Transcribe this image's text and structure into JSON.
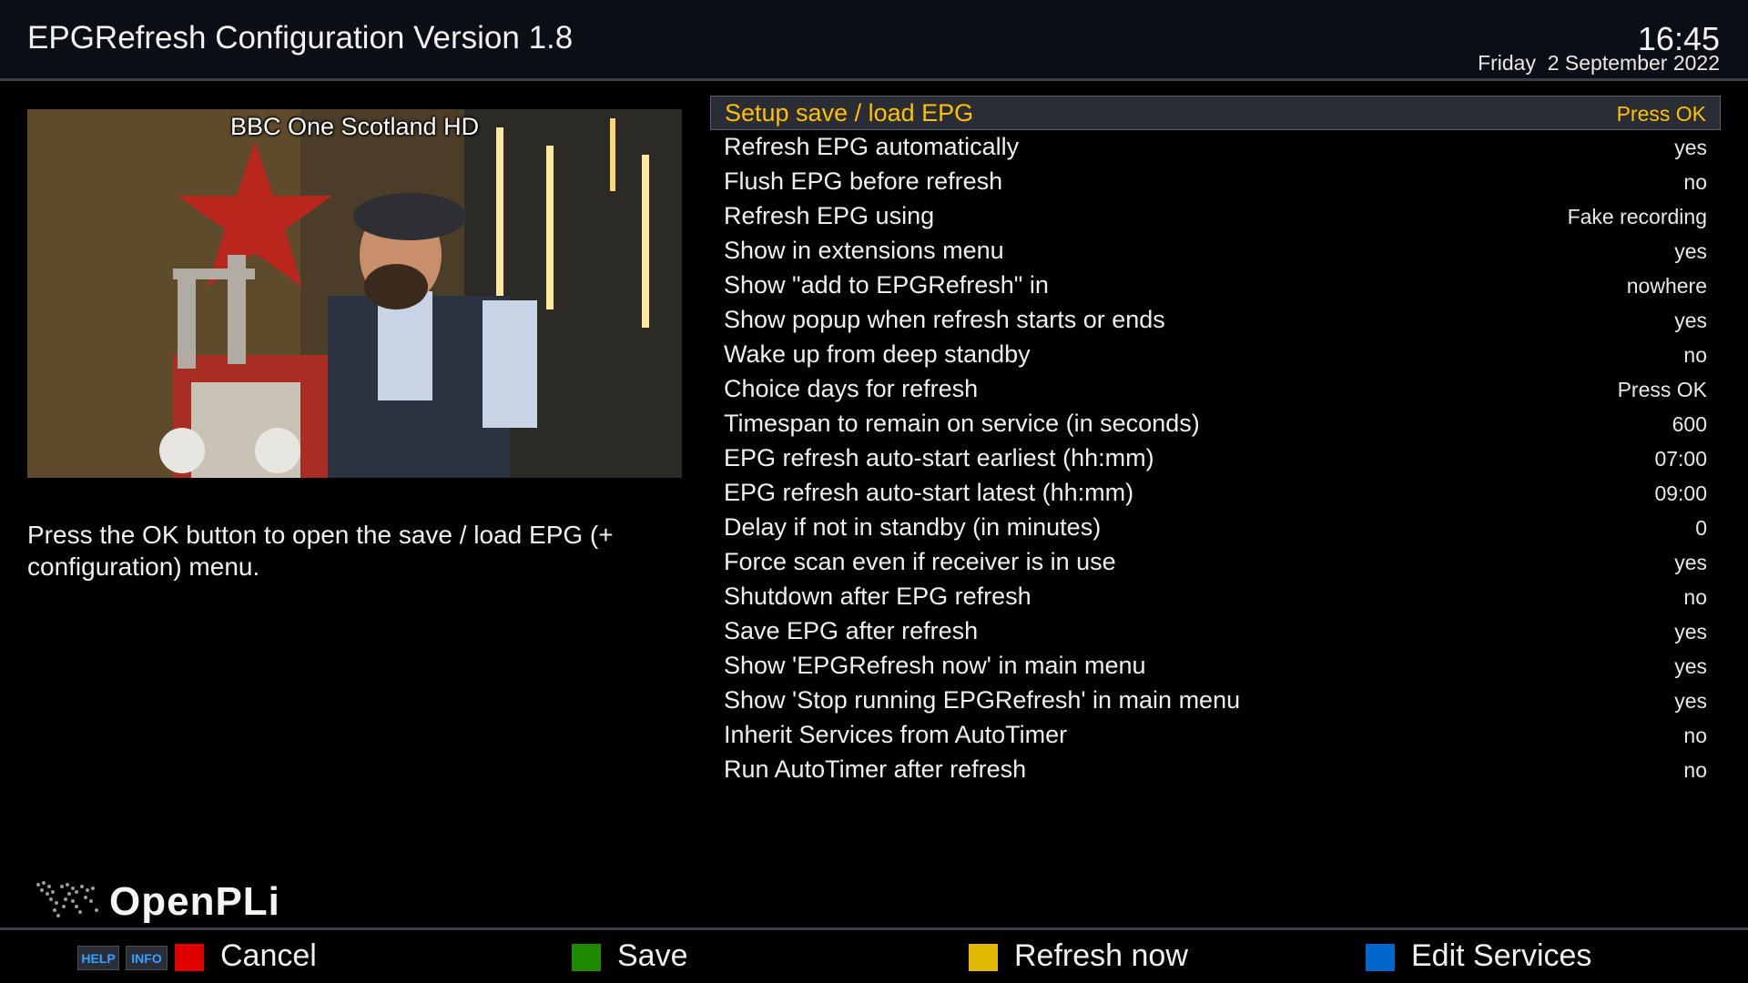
{
  "header": {
    "title": "EPGRefresh Configuration Version 1.8",
    "clock": "16:45",
    "date": "Friday  2 September 2022"
  },
  "preview": {
    "channel": "BBC One Scotland HD"
  },
  "description": "Press the OK button to open the save / load EPG (+ configuration) menu.",
  "settings": [
    {
      "label": "Setup save / load EPG",
      "value": "Press OK"
    },
    {
      "label": "Refresh EPG automatically",
      "value": "yes"
    },
    {
      "label": "Flush EPG before refresh",
      "value": "no"
    },
    {
      "label": "Refresh EPG using",
      "value": "Fake recording"
    },
    {
      "label": "Show in extensions menu",
      "value": "yes"
    },
    {
      "label": "Show \"add to EPGRefresh\" in",
      "value": "nowhere"
    },
    {
      "label": "Show popup when refresh starts or ends",
      "value": "yes"
    },
    {
      "label": "Wake up from deep standby",
      "value": "no"
    },
    {
      "label": "Choice days for refresh",
      "value": "Press OK"
    },
    {
      "label": "Timespan to remain on service (in seconds)",
      "value": "600"
    },
    {
      "label": "EPG refresh auto-start earliest (hh:mm)",
      "value": "07:00"
    },
    {
      "label": "EPG refresh auto-start latest (hh:mm)",
      "value": "09:00"
    },
    {
      "label": "Delay if not in standby (in minutes)",
      "value": "0"
    },
    {
      "label": "Force scan even if receiver is in use",
      "value": "yes"
    },
    {
      "label": "Shutdown after EPG refresh",
      "value": "no"
    },
    {
      "label": "Save EPG after refresh",
      "value": "yes"
    },
    {
      "label": "Show 'EPGRefresh now' in main menu",
      "value": "yes"
    },
    {
      "label": "Show 'Stop running EPGRefresh' in main menu",
      "value": "yes"
    },
    {
      "label": "Inherit Services from AutoTimer",
      "value": "no"
    },
    {
      "label": "Run AutoTimer after refresh",
      "value": "no"
    }
  ],
  "logo": {
    "text": "OpenPLi"
  },
  "footer": {
    "help_key": "HELP",
    "info_key": "INFO",
    "red": {
      "label": "Cancel",
      "color": "#e00000"
    },
    "green": {
      "label": "Save",
      "color": "#1e8a00"
    },
    "yellow": {
      "label": "Refresh now",
      "color": "#e0b800"
    },
    "blue": {
      "label": "Edit Services",
      "color": "#0066cc"
    }
  },
  "colors": {
    "selected_text": "#ffc000",
    "header_bg": "#0b0e14"
  }
}
